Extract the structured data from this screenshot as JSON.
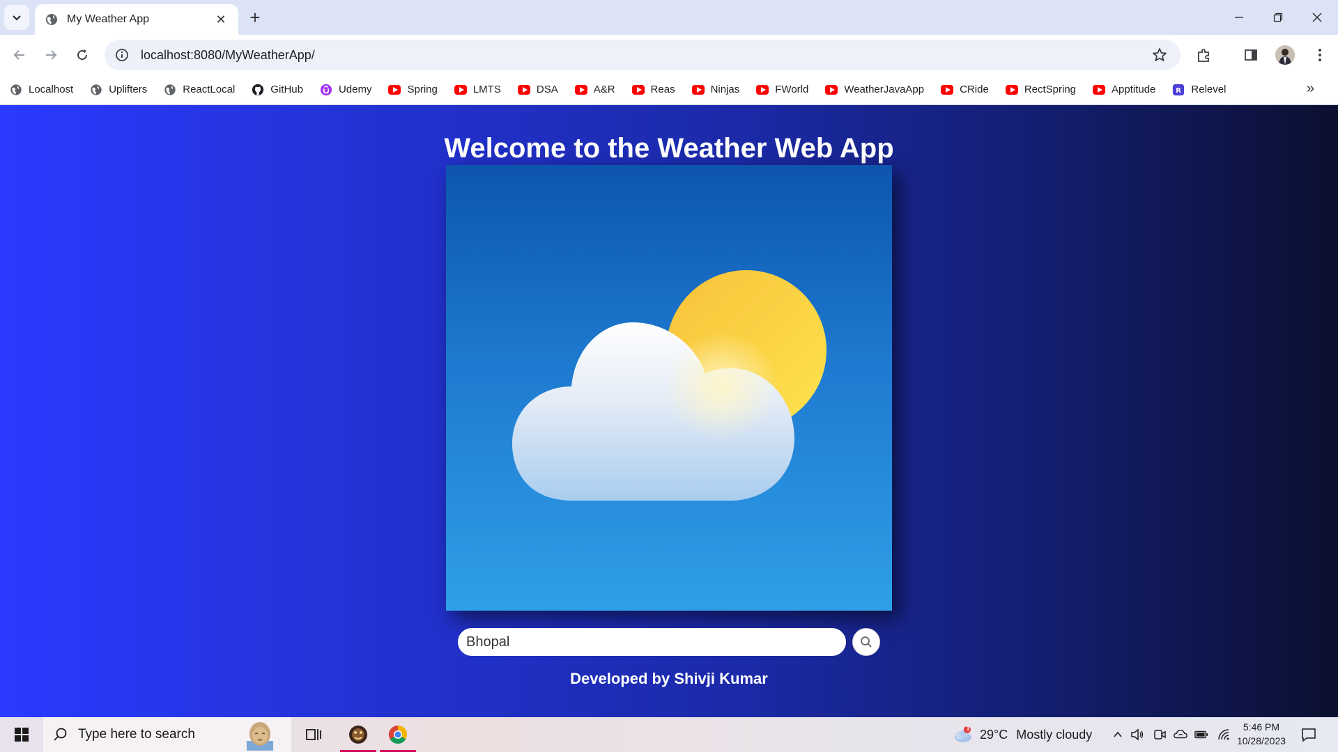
{
  "browser": {
    "tab_title": "My Weather App",
    "tab_close": "✕",
    "new_tab": "+",
    "url": "localhost:8080/MyWeatherApp/"
  },
  "bookmarks": [
    {
      "label": "Localhost",
      "icon": "globe-icon"
    },
    {
      "label": "Uplifters",
      "icon": "globe-icon"
    },
    {
      "label": "ReactLocal",
      "icon": "globe-icon"
    },
    {
      "label": "GitHub",
      "icon": "github-icon"
    },
    {
      "label": "Udemy",
      "icon": "udemy-icon"
    },
    {
      "label": "Spring",
      "icon": "youtube-icon"
    },
    {
      "label": "LMTS",
      "icon": "youtube-icon"
    },
    {
      "label": "DSA",
      "icon": "youtube-icon"
    },
    {
      "label": "A&R",
      "icon": "youtube-icon"
    },
    {
      "label": "Reas",
      "icon": "youtube-icon"
    },
    {
      "label": "Ninjas",
      "icon": "youtube-icon"
    },
    {
      "label": "FWorld",
      "icon": "youtube-icon"
    },
    {
      "label": "WeatherJavaApp",
      "icon": "youtube-icon"
    },
    {
      "label": "CRide",
      "icon": "youtube-icon"
    },
    {
      "label": "RectSpring",
      "icon": "youtube-icon"
    },
    {
      "label": "Apptitude",
      "icon": "youtube-icon"
    },
    {
      "label": "Relevel",
      "icon": "relevel-icon"
    }
  ],
  "bookmarks_overflow": "»",
  "relevel_letter": "R",
  "page": {
    "title": "Welcome to the Weather Web App",
    "search_value": "Bhopal",
    "credit": "Developed by Shivji Kumar"
  },
  "taskbar": {
    "search_placeholder": "Type here to search",
    "weather_temp": "29°C",
    "weather_desc": "Mostly cloudy",
    "weather_badge": "1",
    "time": "5:46 PM",
    "date": "10/28/2023"
  },
  "colors": {
    "page_gradient_start": "#2a3aff",
    "page_gradient_end": "#0b1030",
    "card_top": "#0d55ae",
    "card_bottom": "#2f9fe8",
    "sun": "#fcd44a",
    "youtube_red": "#ff0000",
    "active_app_underline": "#d6005f"
  }
}
